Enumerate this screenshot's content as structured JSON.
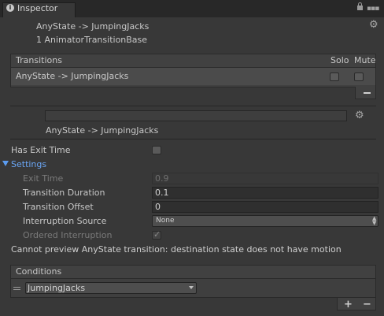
{
  "tab": {
    "icon": "info-icon",
    "label": "Inspector"
  },
  "header": {
    "title": "AnyState -> JumpingJacks",
    "subtitle": "1 AnimatorTransitionBase"
  },
  "transitions": {
    "title": "Transitions",
    "solo_label": "Solo",
    "mute_label": "Mute",
    "rows": [
      {
        "label": "AnyState -> JumpingJacks",
        "solo": false,
        "mute": false
      }
    ]
  },
  "transition_name": "AnyState -> JumpingJacks",
  "has_exit_time": {
    "label": "Has Exit Time",
    "checked": false
  },
  "settings": {
    "label": "Settings",
    "exit_time": {
      "label": "Exit Time",
      "value": "0.9"
    },
    "duration": {
      "label": "Transition Duration",
      "value": "0.1"
    },
    "offset": {
      "label": "Transition Offset",
      "value": "0"
    },
    "interruption": {
      "label": "Interruption Source",
      "value": "None"
    },
    "ordered": {
      "label": "Ordered Interruption",
      "checked": true
    }
  },
  "preview_message": "Cannot preview AnyState transition:  destination state does not have motion",
  "conditions": {
    "title": "Conditions",
    "items": [
      {
        "parameter": "JumpingJacks"
      }
    ],
    "add_label": "+",
    "remove_label": "−"
  }
}
